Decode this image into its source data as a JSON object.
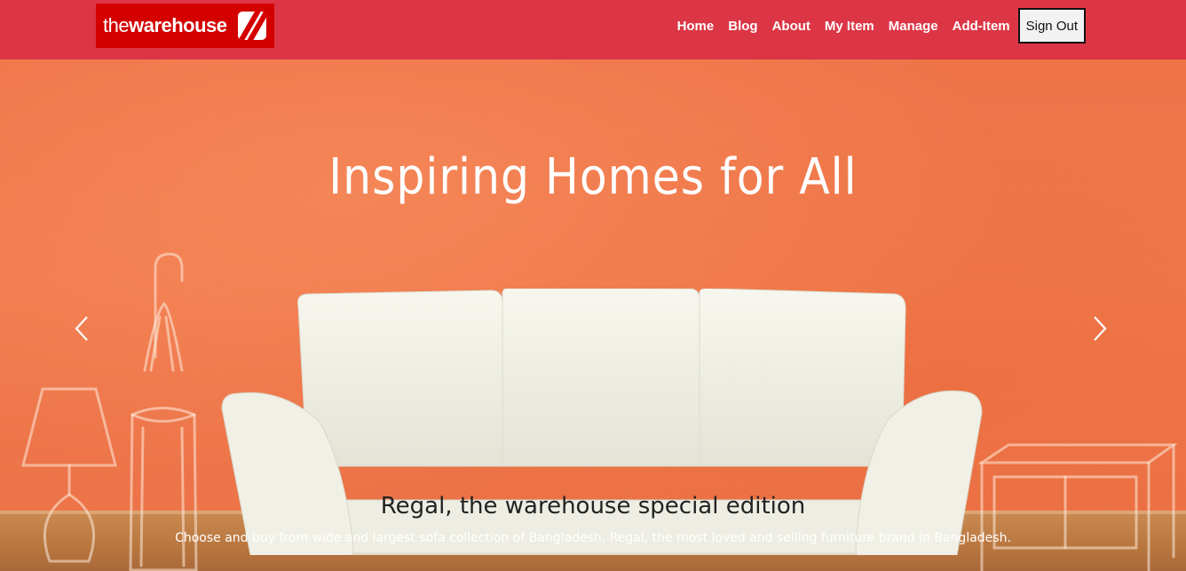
{
  "brand": {
    "logo_thin": "the",
    "logo_bold": "warehouse"
  },
  "nav": {
    "items": [
      {
        "label": "Home"
      },
      {
        "label": "Blog"
      },
      {
        "label": "About"
      },
      {
        "label": "My Item"
      },
      {
        "label": "Manage"
      },
      {
        "label": "Add-Item"
      }
    ],
    "signout_label": "Sign Out"
  },
  "hero": {
    "title": "Inspiring Homes for All",
    "caption_title": "Regal, the warehouse special edition",
    "caption_text": "Choose and buy from wide and largest sofa collection of Bangladesh. Regal, the most loved and selling furniture brand in Bangladesh."
  },
  "icons": {
    "prev": "chevron-left-icon",
    "next": "chevron-right-icon"
  },
  "colors": {
    "navbar": "#dc3545",
    "logo_bg": "#d40000",
    "hero_wall": "#f07a4d"
  }
}
